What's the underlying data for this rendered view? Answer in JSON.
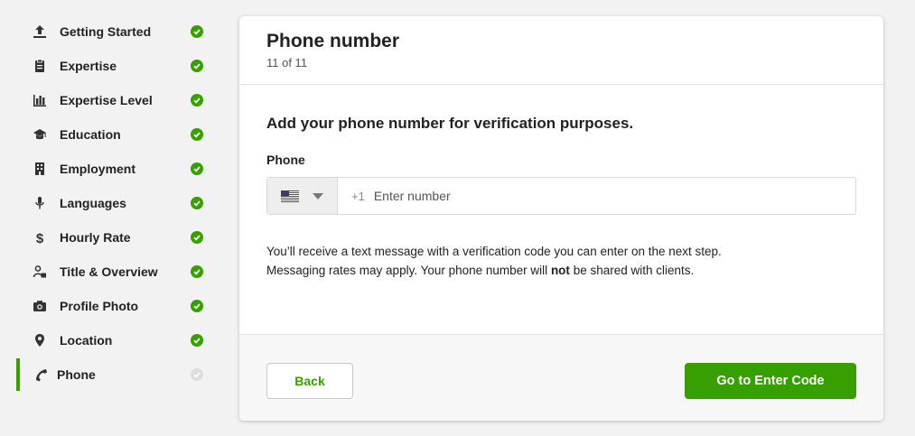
{
  "colors": {
    "accent": "#37a000",
    "pending": "#dddddd"
  },
  "sidebar": {
    "items": [
      {
        "label": "Getting Started",
        "icon": "upload-icon",
        "status": "complete"
      },
      {
        "label": "Expertise",
        "icon": "clipboard-icon",
        "status": "complete"
      },
      {
        "label": "Expertise Level",
        "icon": "bar-chart-icon",
        "status": "complete"
      },
      {
        "label": "Education",
        "icon": "graduation-cap-icon",
        "status": "complete"
      },
      {
        "label": "Employment",
        "icon": "building-icon",
        "status": "complete"
      },
      {
        "label": "Languages",
        "icon": "microphone-icon",
        "status": "complete"
      },
      {
        "label": "Hourly Rate",
        "icon": "dollar-icon",
        "status": "complete"
      },
      {
        "label": "Title & Overview",
        "icon": "person-profile-icon",
        "status": "complete"
      },
      {
        "label": "Profile Photo",
        "icon": "camera-icon",
        "status": "complete"
      },
      {
        "label": "Location",
        "icon": "map-pin-icon",
        "status": "complete"
      },
      {
        "label": "Phone",
        "icon": "phone-icon",
        "status": "pending",
        "active": true
      }
    ]
  },
  "card": {
    "title": "Phone number",
    "step": "11 of 11",
    "heading": "Add your phone number for verification purposes.",
    "phone_label": "Phone",
    "country_icon": "us-flag-icon",
    "dial_prefix": "+1",
    "phone_placeholder": "Enter number",
    "phone_value": "",
    "note_line1": "You’ll receive a text message with a verification code you can enter on the next step.",
    "note_line2_before": "Messaging rates may apply. Your phone number will ",
    "note_line2_emphasis": "not",
    "note_line2_after": " be shared with clients.",
    "back_label": "Back",
    "next_label": "Go to Enter Code"
  }
}
